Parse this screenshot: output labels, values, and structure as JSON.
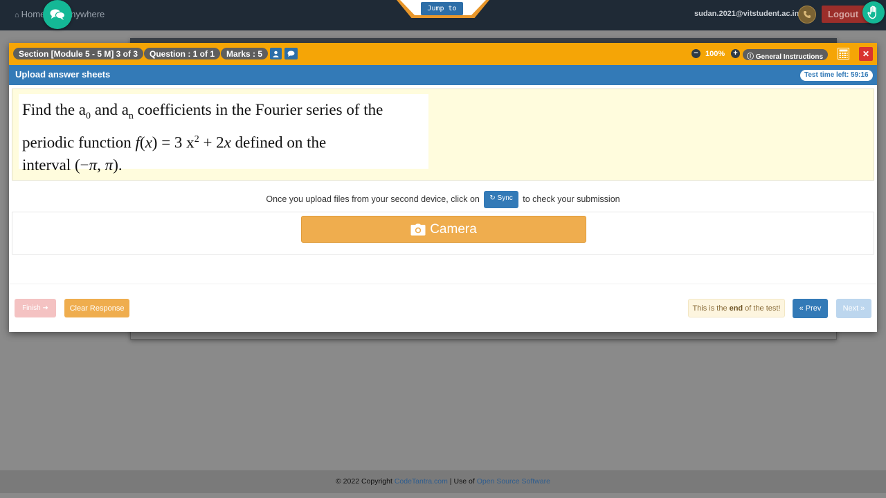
{
  "navbar": {
    "home_label": "Home",
    "tagline_fragment": "n Anywhere",
    "jump_label": "Jump to",
    "user_email": "sudan.2021@vitstudent.ac.in",
    "logout_label": "Logout"
  },
  "toolbar": {
    "section_label": "Section [Module 5 - 5 M] 3 of 3",
    "question_label": "Question : 1 of 1",
    "marks_label": "Marks : 5",
    "zoom_value": "100%",
    "general_instructions_label": "General Instructions"
  },
  "panel": {
    "title": "Upload answer sheets",
    "time_left": "Test time left: 59:16"
  },
  "question": {
    "line1_a": "Find the a",
    "line1_sub0": "0",
    "line1_b": " and a",
    "line1_subn": "n",
    "line1_c": " coefficients in the Fourier series of the",
    "line2_a": "periodic function ",
    "line2_func": "f",
    "line2_b": "(",
    "line2_var": "x",
    "line2_c": ") = 3 x",
    "line2_exp": "2",
    "line2_d": " + 2",
    "line2_var2": "x",
    "line2_e": " defined on the",
    "line3_a": "interval (−",
    "line3_pi1": "π",
    "line3_b": ", ",
    "line3_pi2": "π",
    "line3_c": ")."
  },
  "upload": {
    "instruction_before": "Once you upload files from your second device, click on",
    "sync_label": "Sync",
    "instruction_after": "to check your submission",
    "camera_label": "Camera"
  },
  "actions": {
    "finish_label": "Finish",
    "clear_label": "Clear Response",
    "end_note_before": "This is the",
    "end_note_bold": "end",
    "end_note_after": "of the test!",
    "prev_label": "« Prev",
    "next_label": "Next »"
  },
  "footer": {
    "copyright": "© 2022 Copyright",
    "codetantra_link": "CodeTantra.com",
    "separator": "| Use of",
    "oss_link": "Open Source Software"
  },
  "colors": {
    "orange_bar": "#f5a506",
    "blue_bar": "#337ab7",
    "teal_fab": "#14b896",
    "danger": "#d9332f"
  },
  "icons": {
    "home": "home-icon",
    "chat": "chat-icon",
    "hand": "hand-icon",
    "phone": "phone-icon",
    "user": "user-icon",
    "comment": "comment-icon",
    "zoom_out": "minus-circle-icon",
    "zoom_in": "plus-circle-icon",
    "info": "info-icon",
    "calculator": "calculator-icon",
    "close": "close-icon",
    "sync": "sync-icon",
    "camera": "camera-icon"
  }
}
